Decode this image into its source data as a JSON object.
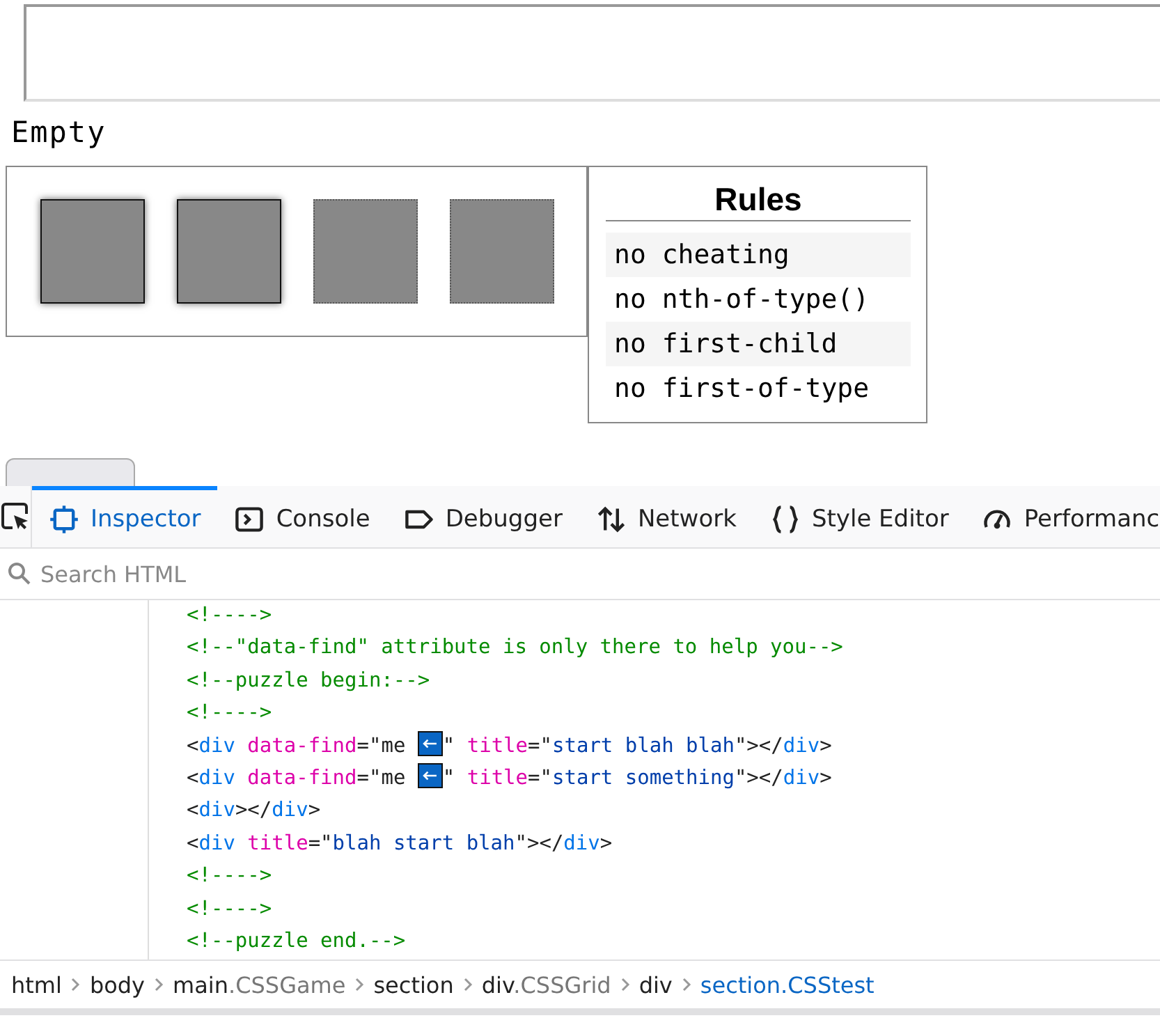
{
  "game": {
    "status": "Empty",
    "boxes": [
      {
        "highlighted": true
      },
      {
        "highlighted": true
      },
      {
        "highlighted": false
      },
      {
        "highlighted": false
      }
    ],
    "rules": {
      "title": "Rules",
      "items": [
        "no cheating",
        "no nth-of-type()",
        "no first-child",
        "no first-of-type"
      ]
    },
    "button": {
      "kind": "cut"
    }
  },
  "devtools": {
    "tabs": [
      {
        "label": "Inspector",
        "selected": true
      },
      {
        "label": "Console",
        "selected": false
      },
      {
        "label": "Debugger",
        "selected": false
      },
      {
        "label": "Network",
        "selected": false
      },
      {
        "label": "Style Editor",
        "selected": false
      },
      {
        "label": "Performanc",
        "selected": false
      }
    ],
    "search": {
      "placeholder": "Search HTML"
    },
    "code_lines": [
      [
        {
          "kind": "comment",
          "text": "<!---->"
        }
      ],
      [
        {
          "kind": "comment",
          "text": "<!--\"data-find\" attribute is only there to help you-->"
        }
      ],
      [
        {
          "kind": "comment",
          "text": "<!--puzzle begin:-->"
        }
      ],
      [
        {
          "kind": "comment",
          "text": "<!---->"
        }
      ],
      [
        {
          "kind": "punct",
          "text": "<"
        },
        {
          "kind": "tag",
          "text": "div"
        },
        {
          "kind": "attr",
          "text": " data-find"
        },
        {
          "kind": "punct",
          "text": "=\"me "
        },
        {
          "kind": "badge"
        },
        {
          "kind": "punct",
          "text": "\""
        },
        {
          "kind": "attr",
          "text": " title"
        },
        {
          "kind": "punct",
          "text": "=\""
        },
        {
          "kind": "value",
          "text": "start blah blah"
        },
        {
          "kind": "punct",
          "text": "\"></"
        },
        {
          "kind": "tag",
          "text": "div"
        },
        {
          "kind": "punct",
          "text": ">"
        }
      ],
      [
        {
          "kind": "punct",
          "text": "<"
        },
        {
          "kind": "tag",
          "text": "div"
        },
        {
          "kind": "attr",
          "text": " data-find"
        },
        {
          "kind": "punct",
          "text": "=\"me "
        },
        {
          "kind": "badge"
        },
        {
          "kind": "punct",
          "text": "\""
        },
        {
          "kind": "attr",
          "text": " title"
        },
        {
          "kind": "punct",
          "text": "=\""
        },
        {
          "kind": "value",
          "text": "start something"
        },
        {
          "kind": "punct",
          "text": "\"></"
        },
        {
          "kind": "tag",
          "text": "div"
        },
        {
          "kind": "punct",
          "text": ">"
        }
      ],
      [
        {
          "kind": "punct",
          "text": "<"
        },
        {
          "kind": "tag",
          "text": "div"
        },
        {
          "kind": "punct",
          "text": "></"
        },
        {
          "kind": "tag",
          "text": "div"
        },
        {
          "kind": "punct",
          "text": ">"
        }
      ],
      [
        {
          "kind": "punct",
          "text": "<"
        },
        {
          "kind": "tag",
          "text": "div"
        },
        {
          "kind": "attr",
          "text": " title"
        },
        {
          "kind": "punct",
          "text": "=\""
        },
        {
          "kind": "value",
          "text": "blah start blah"
        },
        {
          "kind": "punct",
          "text": "\"></"
        },
        {
          "kind": "tag",
          "text": "div"
        },
        {
          "kind": "punct",
          "text": ">"
        }
      ],
      [
        {
          "kind": "comment",
          "text": "<!---->"
        }
      ],
      [
        {
          "kind": "comment",
          "text": "<!---->"
        }
      ],
      [
        {
          "kind": "comment",
          "text": "<!--puzzle end.-->"
        }
      ]
    ],
    "breadcrumbs": [
      {
        "tag": "html",
        "selected": false
      },
      {
        "tag": "body",
        "selected": false
      },
      {
        "tag": "main",
        "class": ".CSSGame",
        "selected": false
      },
      {
        "tag": "section",
        "selected": false
      },
      {
        "tag": "div",
        "class": ".CSSGrid",
        "selected": false
      },
      {
        "tag": "div",
        "selected": false
      },
      {
        "tag": "section",
        "class": ".CSStest",
        "selected": true
      }
    ]
  }
}
